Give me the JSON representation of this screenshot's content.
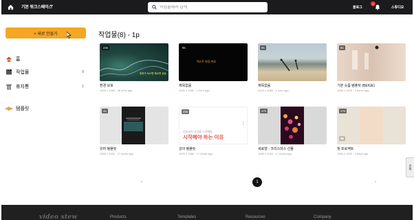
{
  "header": {
    "workspace_label": "기본 워크스페이스",
    "search_placeholder": "작업물에서 검색",
    "blog_label": "블로그",
    "notification_count": "1",
    "studio_label": "스튜디오"
  },
  "sidebar": {
    "new_button_label": "+ 새로 만들기",
    "items": [
      {
        "label": "홈",
        "count": ""
      },
      {
        "label": "작업물",
        "count": "8"
      },
      {
        "label": "휴지통",
        "count": "1"
      },
      {
        "label": "템플릿",
        "count": ""
      }
    ]
  },
  "main": {
    "title": "작업물(8) - 1p",
    "cards": [
      {
        "duration": "24s",
        "title": "환경 보호",
        "meta": "1632 x 1080 · 36 mins ago"
      },
      {
        "duration": "9s",
        "title": "제목없음",
        "meta": "1920 x 1080 · 1 hour ago",
        "overlay_line1": "텍스트 편집 완료",
        "overlay_line2": ""
      },
      {
        "duration": "9s",
        "title": "제목없음",
        "meta": "1920 x 1080 · 1 hour ago"
      },
      {
        "duration": "8s",
        "title": "기본 숏폼 템플릿 (BEIGE)",
        "meta": "1080 x 1920 · 5 hours ago"
      },
      {
        "duration": "4s",
        "title": "유머 템플릿",
        "meta": "1080 x 1920 · 17 hours ago"
      },
      {
        "duration": "20s",
        "title": "강의 템플릿",
        "meta": "1920 x 1080 · 17 hours ago",
        "overlay_small": "인포리어 사업을 시작해야",
        "overlay_big": "시작해야 하는 이유"
      },
      {
        "duration": "17s",
        "title": "세로형 - 크리스마스 선물",
        "meta": "1080 x 1920 · 17 hours ago"
      },
      {
        "duration": "17s",
        "title": "첫 프로젝트",
        "meta": "1080 x 1920 · 4 days ago"
      }
    ]
  },
  "pagination": {
    "prev": "‹",
    "current": "1",
    "next": "›"
  },
  "side_tab_label": "문의",
  "footer": {
    "logo": "video stew",
    "columns": [
      "Products",
      "Templates",
      "Resources",
      "Company"
    ]
  },
  "colors": {
    "accent": "#f5a623",
    "topbar": "#1b1b1d",
    "notification": "#e33333",
    "footer": "#202020"
  }
}
